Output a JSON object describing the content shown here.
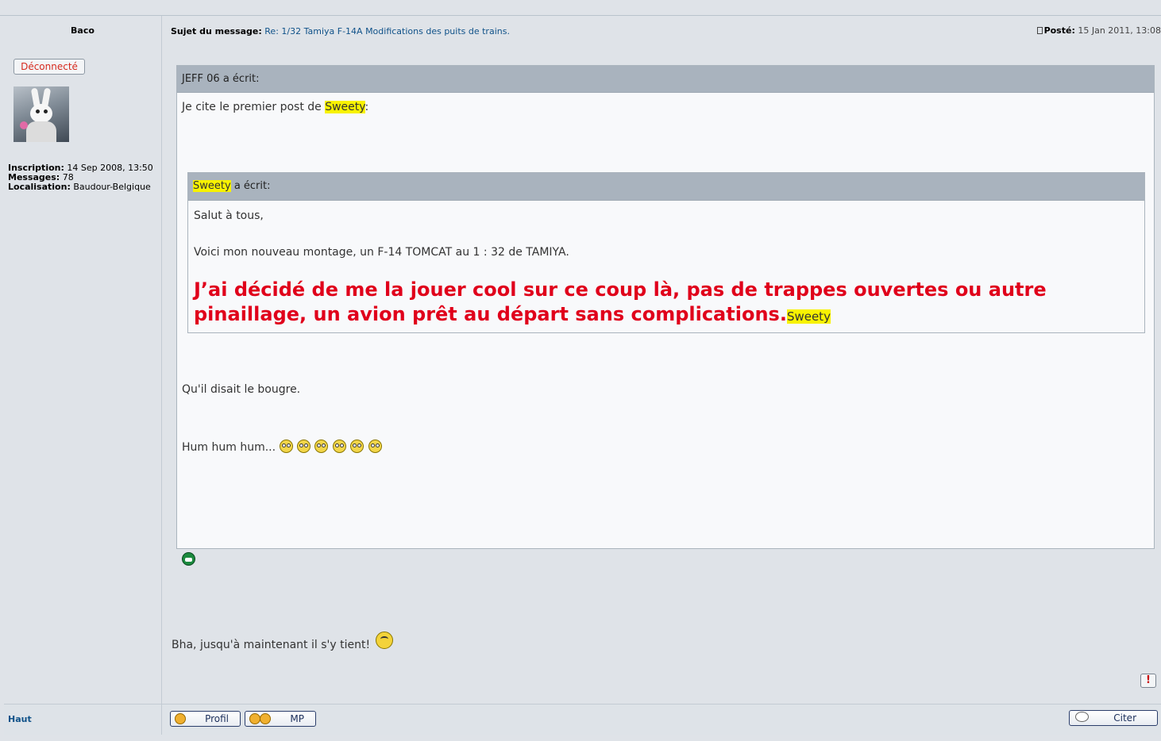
{
  "author": {
    "name": "Baco",
    "status": "Déconnecté",
    "avatar_icon": "rabbid-avatar",
    "inscription_label": "Inscription:",
    "inscription_value": "14 Sep 2008, 13:50",
    "messages_label": "Messages:",
    "messages_value": "78",
    "localisation_label": "Localisation:",
    "localisation_value": "Baudour-Belgique"
  },
  "post": {
    "subject_label": "Sujet du message:",
    "subject": "Re: 1/32 Tamiya F-14A Modifications des puits de trains.",
    "posted_label": "Posté:",
    "posted_date": "15 Jan 2011, 13:08",
    "quote1_author": "JEFF 06",
    "quote1_wrote": "a écrit:",
    "quote1_intro": "Je cite le premier post de",
    "quote1_intro_name": "Sweety",
    "quote1_intro_colon": ":",
    "quote2_author": "Sweety",
    "quote2_wrote": "a écrit:",
    "quote2_line1": "Salut à tous,",
    "quote2_line2": "Voici mon nouveau montage, un F-14 TOMCAT au 1 : 32 de TAMIYA.",
    "quote2_big": "J’ai décidé de me la jouer cool sur ce coup là, pas de trappes ouvertes ou autre pinaillage, un avion prêt au départ sans complications.",
    "quote2_sig": "Sweety",
    "quote1_line2": "Qu'il disait le bougre.",
    "quote1_line3": "Hum hum hum...",
    "main_text": "Bha, jusqu'à maintenant il s'y tient!"
  },
  "footer": {
    "top_link": "Haut",
    "profil_button": "Profil",
    "mp_button": "MP",
    "citer_button": "Citer",
    "report_icon": "!"
  },
  "colors": {
    "background": "#dfe3e8",
    "link": "#105289",
    "quote_header": "#a9b3be",
    "highlight": "#f8f200",
    "red_text": "#e0001b"
  }
}
